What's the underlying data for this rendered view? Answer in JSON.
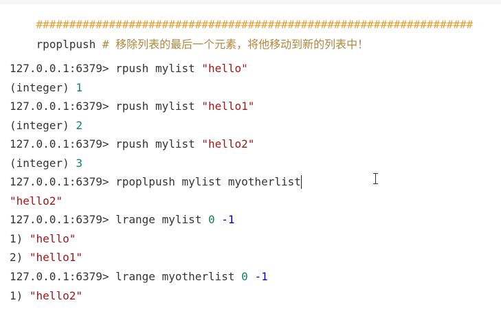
{
  "separator": "##################################################################",
  "header": {
    "command": "rpoplpush",
    "comment": "# 移除列表的最后一个元素，将他移动到新的列表中！"
  },
  "prompt": "127.0.0.1:6379>",
  "session": {
    "cmd1": {
      "text": "rpush mylist ",
      "arg": "\"hello\""
    },
    "out1": {
      "label": "(integer) ",
      "value": "1"
    },
    "cmd2": {
      "text": "rpush mylist ",
      "arg": "\"hello1\""
    },
    "out2": {
      "label": "(integer) ",
      "value": "2"
    },
    "cmd3": {
      "text": "rpush mylist ",
      "arg": "\"hello2\""
    },
    "out3": {
      "label": "(integer) ",
      "value": "3"
    },
    "cmd4": {
      "text": "rpoplpush mylist myotherlist"
    },
    "out4": {
      "value": "\"hello2\""
    },
    "cmd5": {
      "text": "lrange mylist ",
      "start": "0",
      "stop": "-1"
    },
    "out5a": {
      "index": "1) ",
      "value": "\"hello\""
    },
    "out5b": {
      "index": "2) ",
      "value": "\"hello1\""
    },
    "cmd6": {
      "text": "lrange myotherlist ",
      "start": "0",
      "stop": "-1"
    },
    "out6a": {
      "index": "1) ",
      "value": "\"hello2\""
    }
  }
}
